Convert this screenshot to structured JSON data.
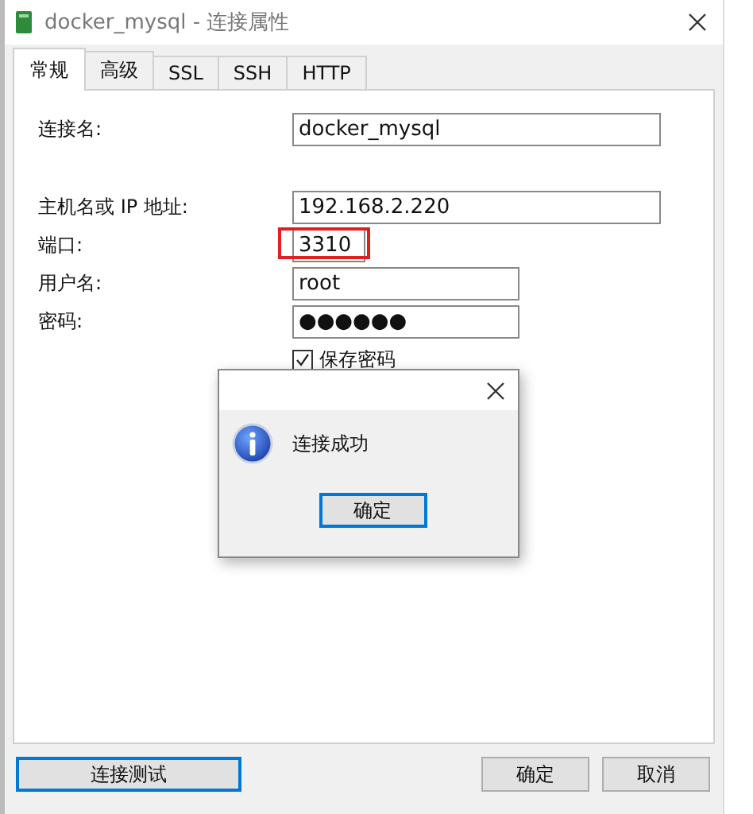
{
  "window": {
    "title": "docker_mysql - 连接属性"
  },
  "tabs": [
    {
      "label": "常规",
      "selected": true
    },
    {
      "label": "高级",
      "selected": false
    },
    {
      "label": "SSL",
      "selected": false
    },
    {
      "label": "SSH",
      "selected": false
    },
    {
      "label": "HTTP",
      "selected": false
    }
  ],
  "fields": [
    {
      "label": "连接名:",
      "value": "docker_mysql",
      "highlighted": false
    },
    {
      "label": "主机名或 IP 地址:",
      "value": "192.168.2.220",
      "highlighted": false
    },
    {
      "label": "端口:",
      "value": "3310",
      "highlighted": true
    },
    {
      "label": "用户名:",
      "value": "root",
      "highlighted": false
    },
    {
      "label": "密码:",
      "value": "●●●●●●",
      "highlighted": false
    }
  ],
  "save_password": {
    "label": "保存密码",
    "checked": true
  },
  "buttons": {
    "test": "连接测试",
    "ok": "确定",
    "cancel": "取消"
  },
  "message_box": {
    "message": "连接成功",
    "ok": "确定"
  }
}
